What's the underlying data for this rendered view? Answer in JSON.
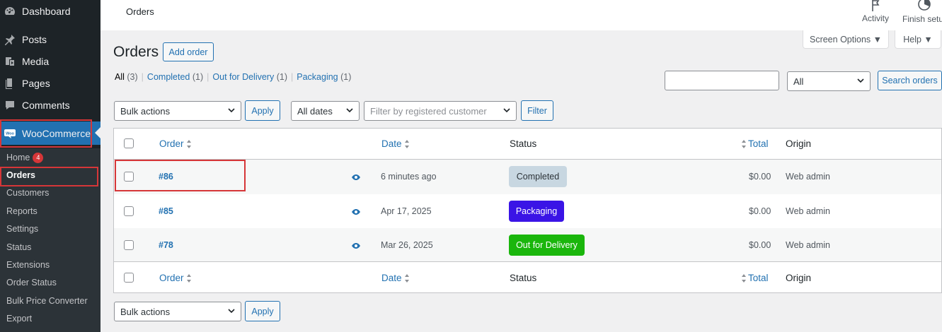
{
  "sidebar": {
    "menu": [
      {
        "label": "Dashboard",
        "icon": "dashboard-icon"
      },
      {
        "label": "Posts",
        "icon": "pin-icon"
      },
      {
        "label": "Media",
        "icon": "media-icon"
      },
      {
        "label": "Pages",
        "icon": "pages-icon"
      },
      {
        "label": "Comments",
        "icon": "comments-icon"
      },
      {
        "label": "WooCommerce",
        "icon": "woo-icon"
      }
    ],
    "submenu": [
      {
        "label": "Home",
        "badge": "4"
      },
      {
        "label": "Orders"
      },
      {
        "label": "Customers"
      },
      {
        "label": "Reports"
      },
      {
        "label": "Settings"
      },
      {
        "label": "Status"
      },
      {
        "label": "Extensions"
      },
      {
        "label": "Order Status"
      },
      {
        "label": "Bulk Price Converter"
      },
      {
        "label": "Export"
      }
    ]
  },
  "topbar": {
    "breadcrumb": "Orders",
    "activity_label": "Activity",
    "finish_setup_label": "Finish setu"
  },
  "meta": {
    "screen_options": "Screen Options ▼",
    "help": "Help ▼"
  },
  "page": {
    "title": "Orders",
    "add_order": "Add order"
  },
  "views": [
    {
      "label": "All",
      "count": "(3)",
      "current": true
    },
    {
      "label": "Completed",
      "count": "(1)"
    },
    {
      "label": "Out for Delivery",
      "count": "(1)"
    },
    {
      "label": "Packaging",
      "count": "(1)"
    }
  ],
  "search": {
    "input_value": "",
    "status_select": "All",
    "button": "Search orders"
  },
  "filters": {
    "bulk_actions": "Bulk actions",
    "apply": "Apply",
    "dates": "All dates",
    "customer_placeholder": "Filter by registered customer",
    "filter": "Filter"
  },
  "table": {
    "columns": {
      "order": "Order",
      "date": "Date",
      "status": "Status",
      "total": "Total",
      "origin": "Origin"
    },
    "rows": [
      {
        "order": "#86",
        "date": "6 minutes ago",
        "status": "Completed",
        "status_bg": "#c8d7e1",
        "status_fg": "#2c3338",
        "total": "$0.00",
        "origin": "Web admin"
      },
      {
        "order": "#85",
        "date": "Apr 17, 2025",
        "status": "Packaging",
        "status_bg": "#3a14e6",
        "status_fg": "#ffffff",
        "total": "$0.00",
        "origin": "Web admin"
      },
      {
        "order": "#78",
        "date": "Mar 26, 2025",
        "status": "Out for Delivery",
        "status_bg": "#1ab60c",
        "status_fg": "#ffffff",
        "total": "$0.00",
        "origin": "Web admin"
      }
    ]
  },
  "bottom": {
    "bulk_actions": "Bulk actions",
    "apply": "Apply"
  },
  "colors": {
    "accent": "#2271b1",
    "highlight": "#d63638"
  }
}
